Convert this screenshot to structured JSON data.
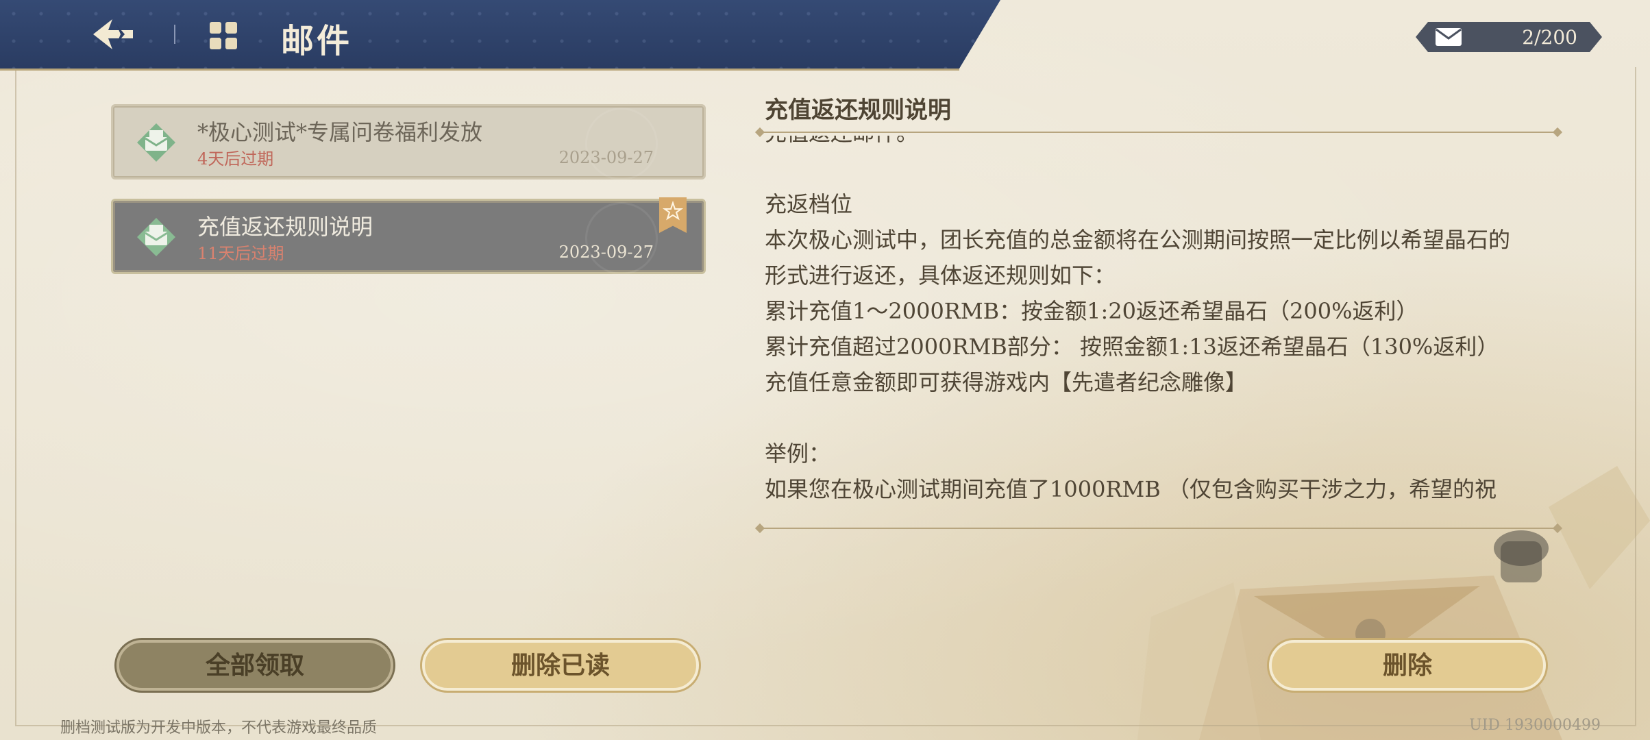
{
  "header": {
    "title": "邮件"
  },
  "mail_counter": {
    "text": "2/200"
  },
  "mail_list": [
    {
      "title": "*极心测试*专属问卷福利发放",
      "expire": "4天后过期",
      "date": "2023-09-27",
      "state": "read"
    },
    {
      "title": "充值返还规则说明",
      "expire": "11天后过期",
      "date": "2023-09-27",
      "state": "selected"
    }
  ],
  "detail": {
    "title": "充值返还规则说明",
    "lines": [
      "充值返还邮件。",
      "",
      " 充返档位",
      "本次极心测试中，团长充值的总金额将在公测期间按照一定比例以希望晶石的",
      "形式进行返还，具体返还规则如下：",
      "累计充值1～2000RMB：按金额1:20返还希望晶石（200%返利）",
      "累计充值超过2000RMB部分： 按照金额1:13返还希望晶石（130%返利）",
      "充值任意金额即可获得游戏内【先遣者纪念雕像】",
      "",
      "举例：",
      "如果您在极心测试期间充值了1000RMB （仅包含购买干涉之力，希望的祝"
    ]
  },
  "buttons": {
    "claim_all": "全部领取",
    "delete_read": "删除已读",
    "delete": "删除"
  },
  "footer": {
    "note": "删档测试版为开发中版本，不代表游戏最终品质",
    "uid": "UID 1930000499"
  }
}
